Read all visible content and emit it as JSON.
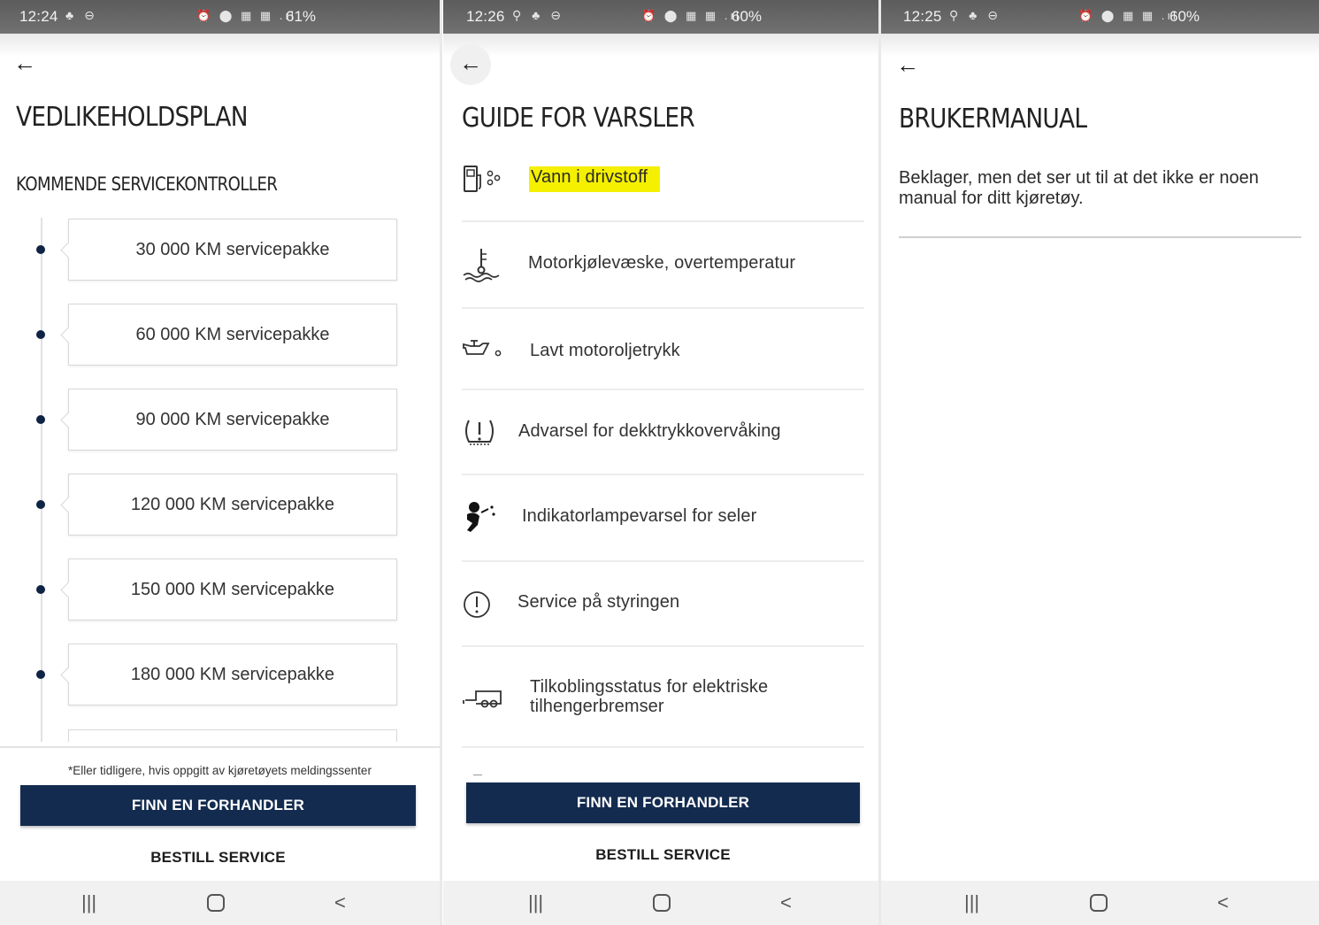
{
  "panel1": {
    "status": {
      "time": "12:24",
      "battery": "61%"
    },
    "title": "VEDLIKEHOLDSPLAN",
    "subtitle": "KOMMENDE SERVICEKONTROLLER",
    "services": [
      "30 000 KM servicepakke",
      "60 000 KM servicepakke",
      "90 000 KM servicepakke",
      "120 000 KM servicepakke",
      "150 000 KM servicepakke",
      "180 000 KM servicepakke"
    ],
    "note": "*Eller tidligere, hvis oppgitt av kjøretøyets meldingssenter",
    "primary_button": "FINN EN FORHANDLER",
    "secondary_button": "BESTILL SERVICE"
  },
  "panel2": {
    "status": {
      "time": "12:26",
      "battery": "60%"
    },
    "title": "GUIDE FOR VARSLER",
    "items": [
      {
        "label": "Vann i drivstoff",
        "icon": "fuel-water-icon"
      },
      {
        "label": "Motorkjølevæske, overtemperatur",
        "icon": "coolant-temperature-icon"
      },
      {
        "label": "Lavt motoroljetrykk",
        "icon": "oil-can-icon"
      },
      {
        "label": "Advarsel for dekktrykkovervåking",
        "icon": "tire-pressure-icon"
      },
      {
        "label": "Indikatorlampevarsel for seler",
        "icon": "airbag-seatbelt-icon"
      },
      {
        "label": "Service på styringen",
        "icon": "exclamation-circle-icon"
      },
      {
        "label": "Tilkoblingsstatus for elektriske tilhengerbremser",
        "icon": "trailer-icon"
      }
    ],
    "primary_button": "FINN EN FORHANDLER",
    "secondary_button": "BESTILL SERVICE"
  },
  "panel3": {
    "status": {
      "time": "12:25",
      "battery": "60%"
    },
    "title": "BRUKERMANUAL",
    "message": "Beklager, men det ser ut til at det ikke er noen manual for ditt kjøretøy."
  },
  "colors": {
    "primary_button": "#132b4f",
    "timeline_dot": "#0f2344",
    "highlight": "#f5f000",
    "status_bar": "#666666"
  }
}
